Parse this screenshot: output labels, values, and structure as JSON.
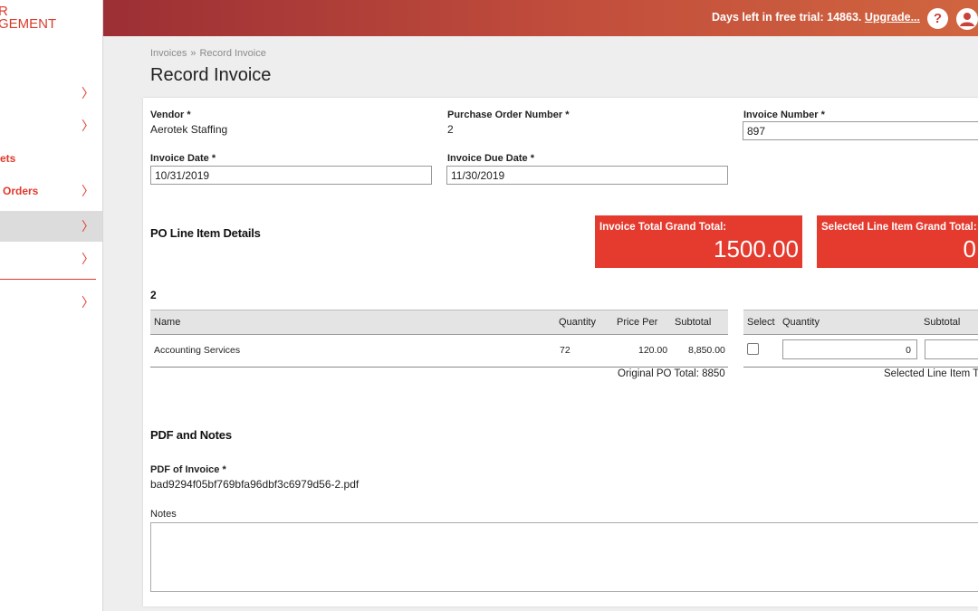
{
  "sidebar": {
    "logo_line1": "R",
    "logo_line2": "GEMENT",
    "items": [
      {
        "label": ""
      },
      {
        "label": ""
      },
      {
        "label": "ets"
      },
      {
        "label": "Orders"
      },
      {
        "label": ""
      },
      {
        "label": ""
      },
      {
        "label": ""
      }
    ]
  },
  "topbar": {
    "trial_text": "Days left in free trial: 14863.",
    "upgrade_label": "Upgrade...",
    "help_icon": "?",
    "user_icon": "user-icon"
  },
  "breadcrumb": {
    "parent": "Invoices",
    "separator": "»",
    "current": "Record Invoice"
  },
  "page_title": "Record Invoice",
  "form": {
    "vendor_label": "Vendor *",
    "vendor_value": "Aerotek Staffing",
    "po_number_label": "Purchase Order Number *",
    "po_number_value": "2",
    "invoice_number_label": "Invoice Number *",
    "invoice_number_value": "897",
    "invoice_date_label": "Invoice Date *",
    "invoice_date_value": "10/31/2019",
    "invoice_due_label": "Invoice Due Date *",
    "invoice_due_value": "11/30/2019"
  },
  "po_section": {
    "title": "PO Line Item Details",
    "invoice_total_label": "Invoice Total Grand Total:",
    "invoice_total_value": "1500.00",
    "selected_total_label": "Selected Line Item Grand Total:",
    "selected_total_value": "0",
    "po_number": "2",
    "columns": [
      "Name",
      "Quantity",
      "Price Per",
      "Subtotal"
    ],
    "rows": [
      {
        "name": "Accounting Services",
        "quantity": "72",
        "price_per": "120.00",
        "subtotal": "8,850.00"
      }
    ],
    "original_po_total": "Original PO Total: 8850",
    "select_columns": [
      "Select",
      "Quantity",
      "Subtotal"
    ],
    "select_quantity_value": "0",
    "selected_line_item_total": "Selected Line Item T"
  },
  "pdf_section": {
    "title": "PDF and Notes",
    "pdf_label": "PDF of Invoice *",
    "pdf_filename": "bad9294f05bf769bfa96dbf3c6979d56-2.pdf",
    "notes_label": "Notes"
  }
}
